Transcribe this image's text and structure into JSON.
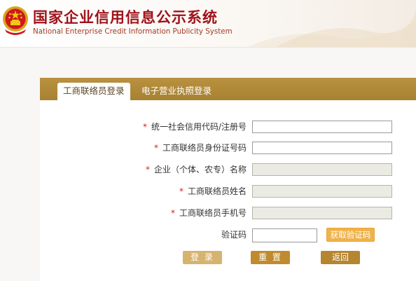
{
  "header": {
    "title_cn": "国家企业信用信息公示系统",
    "title_en": "National Enterprise Credit Information Publicity System",
    "emblem_icon": "national-emblem-icon"
  },
  "tabs": [
    {
      "label": "工商联络员登录",
      "active": true
    },
    {
      "label": "电子营业执照登录",
      "active": false
    }
  ],
  "form": {
    "required_mark": "*",
    "fields": [
      {
        "label": "统一社会信用代码/注册号",
        "required": true,
        "value": "",
        "disabled": false
      },
      {
        "label": "工商联络员身份证号码",
        "required": true,
        "value": "",
        "disabled": false
      },
      {
        "label": "企业（个体、农专）名称",
        "required": true,
        "value": "",
        "disabled": true
      },
      {
        "label": "工商联络员姓名",
        "required": true,
        "value": "",
        "disabled": true
      },
      {
        "label": "工商联络员手机号",
        "required": true,
        "value": "",
        "disabled": true
      }
    ],
    "captcha": {
      "label": "验证码",
      "value": "",
      "button_label": "获取验证码"
    }
  },
  "buttons": {
    "login": "登 录",
    "reset": "重 置",
    "back": "返回"
  },
  "colors": {
    "brand_red": "#a0121a",
    "tab_bar": "#b08a38",
    "captcha_button": "#f0b24a",
    "login_button": "#d6b36e",
    "reset_button": "#c08b2e",
    "required_star": "#d22222"
  }
}
